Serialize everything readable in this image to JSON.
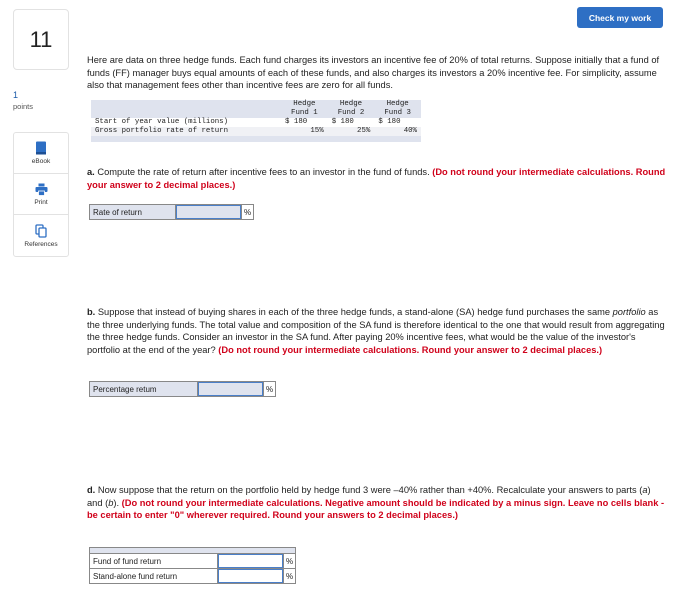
{
  "header": {
    "check_button_label": "Check my work"
  },
  "question": {
    "number": "11",
    "points_value": "1",
    "points_label": "points"
  },
  "tools": [
    {
      "icon": "ebook-icon",
      "label": "eBook"
    },
    {
      "icon": "print-icon",
      "label": "Print"
    },
    {
      "icon": "references-icon",
      "label": "References"
    }
  ],
  "intro": "Here are data on three hedge funds. Each fund charges its investors an incentive fee of 20% of total returns. Suppose initially that a fund of funds (FF) manager buys equal amounts of each of these funds, and also charges its investors a 20% incentive fee. For simplicity, assume also that management fees other than incentive fees are zero for all funds.",
  "table": {
    "headers": [
      {
        "line1": "Hedge",
        "line2": "Fund 1"
      },
      {
        "line1": "Hedge",
        "line2": "Fund 2"
      },
      {
        "line1": "Hedge",
        "line2": "Fund 3"
      }
    ],
    "rows": [
      {
        "label": "Start of year value (millions)",
        "values": [
          "$ 180",
          "$ 180",
          "$ 180"
        ]
      },
      {
        "label": "Gross portfolio rate of return",
        "values": [
          "15%",
          "25%",
          "40%"
        ]
      }
    ]
  },
  "part_a": {
    "letter": "a.",
    "text": " Compute the rate of return after incentive fees to an investor in the fund of funds. ",
    "instruction": "(Do not round your intermediate calculations. Round your answer to 2 decimal places.)",
    "rows": [
      {
        "label": "Rate of return",
        "value": "",
        "unit": "%"
      }
    ]
  },
  "part_b": {
    "letter": "b.",
    "text_1": " Suppose that instead of buying shares in each of the three hedge funds, a stand-alone (SA) hedge fund purchases the same ",
    "text_italic": "portfolio",
    "text_2": " as the three underlying funds. The total value and composition of the SA fund is therefore identical to the one that would result from aggregating the three hedge funds. Consider an investor in the SA fund. After paying 20% incentive fees, what would be the value of the investor's portfolio at the end of the year? ",
    "instruction": "(Do not round your intermediate calculations. Round your answer to 2 decimal places.)",
    "rows": [
      {
        "label": "Percentage retum",
        "value": "",
        "unit": "%"
      }
    ]
  },
  "part_d": {
    "letter": "d.",
    "text_1": " Now suppose that the return on the portfolio held by hedge fund 3 were –40% rather than +40%. Recalculate your answers to parts (",
    "text_a": "a",
    "text_2": ") and (",
    "text_b": "b",
    "text_3": "). ",
    "instruction": "(Do not round your intermediate calculations. Negative amount should be indicated by a minus sign. Leave no cells blank - be certain to enter \"0\" wherever required. Round your answers to 2 decimal places.)",
    "rows": [
      {
        "label": "Fund of fund return",
        "value": "",
        "unit": "%"
      },
      {
        "label": "Stand-alone fund return",
        "value": "",
        "unit": "%"
      }
    ]
  },
  "colors": {
    "accent": "#2e6fc4",
    "instruction_red": "#d0021b",
    "table_header_bg": "#dfe3ee",
    "input_border": "#4a7fc9"
  }
}
